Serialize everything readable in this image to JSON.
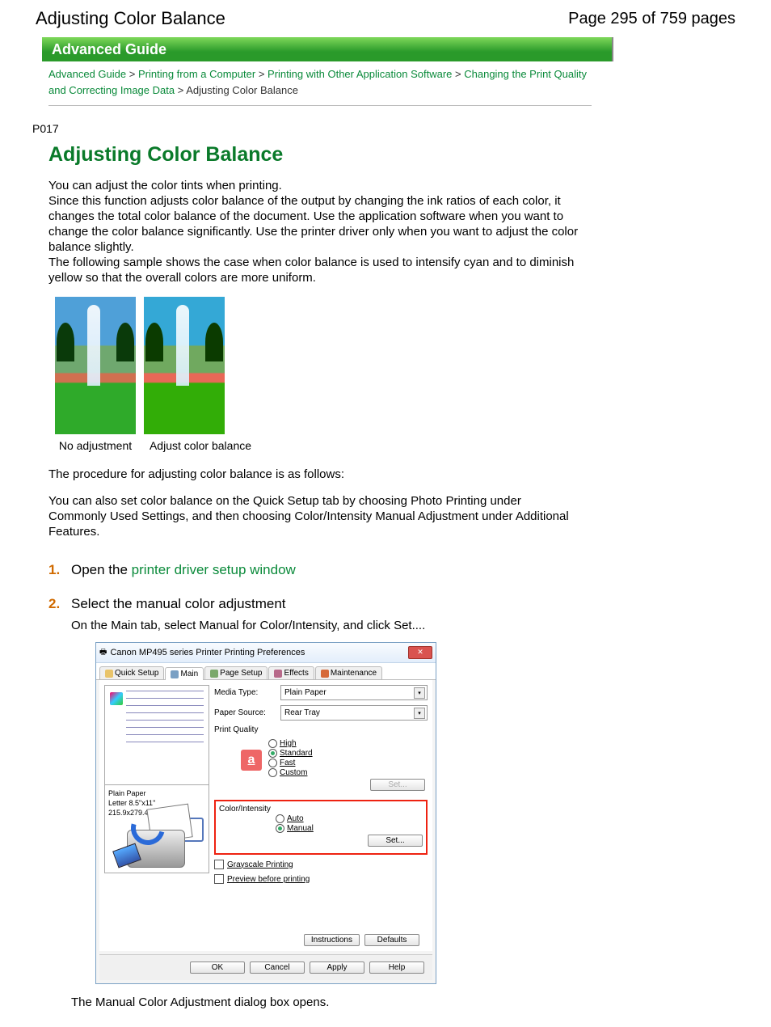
{
  "header": {
    "title": "Adjusting Color Balance",
    "pageInfo": "Page 295 of 759 pages"
  },
  "banner": "Advanced Guide",
  "breadcrumbs": {
    "items": [
      "Advanced Guide",
      "Printing from a Computer",
      "Printing with Other Application Software",
      "Changing the Print Quality and Correcting Image Data"
    ],
    "current": "Adjusting Color Balance",
    "sep": ">"
  },
  "pageCode": "P017",
  "mainTitle": "Adjusting Color Balance",
  "intro": "You can adjust the color tints when printing.\nSince this function adjusts color balance of the output by changing the ink ratios of each color, it changes the total color balance of the document. Use the application software when you want to change the color balance significantly. Use the printer driver only when you want to adjust the color balance slightly.\nThe following sample shows the case when color balance is used to intensify cyan and to diminish yellow so that the overall colors are more uniform.",
  "captions": {
    "left": "No adjustment",
    "right": "Adjust color balance"
  },
  "procLine": "The procedure for adjusting color balance is as follows:",
  "quickSetupLine": "You can also set color balance on the Quick Setup tab by choosing Photo Printing under Commonly Used Settings, and then choosing Color/Intensity Manual Adjustment under Additional Features.",
  "steps": {
    "s1": {
      "pre": "Open the ",
      "link": "printer driver setup window"
    },
    "s2": {
      "head": "Select the manual color adjustment",
      "sub": "On the Main tab, select Manual for Color/Intensity, and click Set....",
      "after": "The Manual Color Adjustment dialog box opens."
    }
  },
  "dialog": {
    "title": "Canon MP495 series Printer Printing Preferences",
    "tabs": [
      "Quick Setup",
      "Main",
      "Page Setup",
      "Effects",
      "Maintenance"
    ],
    "mediaTypeLabel": "Media Type:",
    "mediaType": "Plain Paper",
    "paperSourceLabel": "Paper Source:",
    "paperSource": "Rear Tray",
    "printQualityLabel": "Print Quality",
    "pq": {
      "high": "High",
      "standard": "Standard",
      "fast": "Fast",
      "custom": "Custom"
    },
    "setBtn": "Set...",
    "colorIntensityLabel": "Color/Intensity",
    "ci": {
      "auto": "Auto",
      "manual": "Manual"
    },
    "grayscale": "Grayscale Printing",
    "preview": "Preview before printing",
    "previewInfo": "Plain Paper\nLetter 8.5\"x11\" 215.9x279.4mm",
    "instructions": "Instructions",
    "defaults": "Defaults",
    "ok": "OK",
    "cancel": "Cancel",
    "apply": "Apply",
    "help": "Help",
    "a": "a"
  }
}
